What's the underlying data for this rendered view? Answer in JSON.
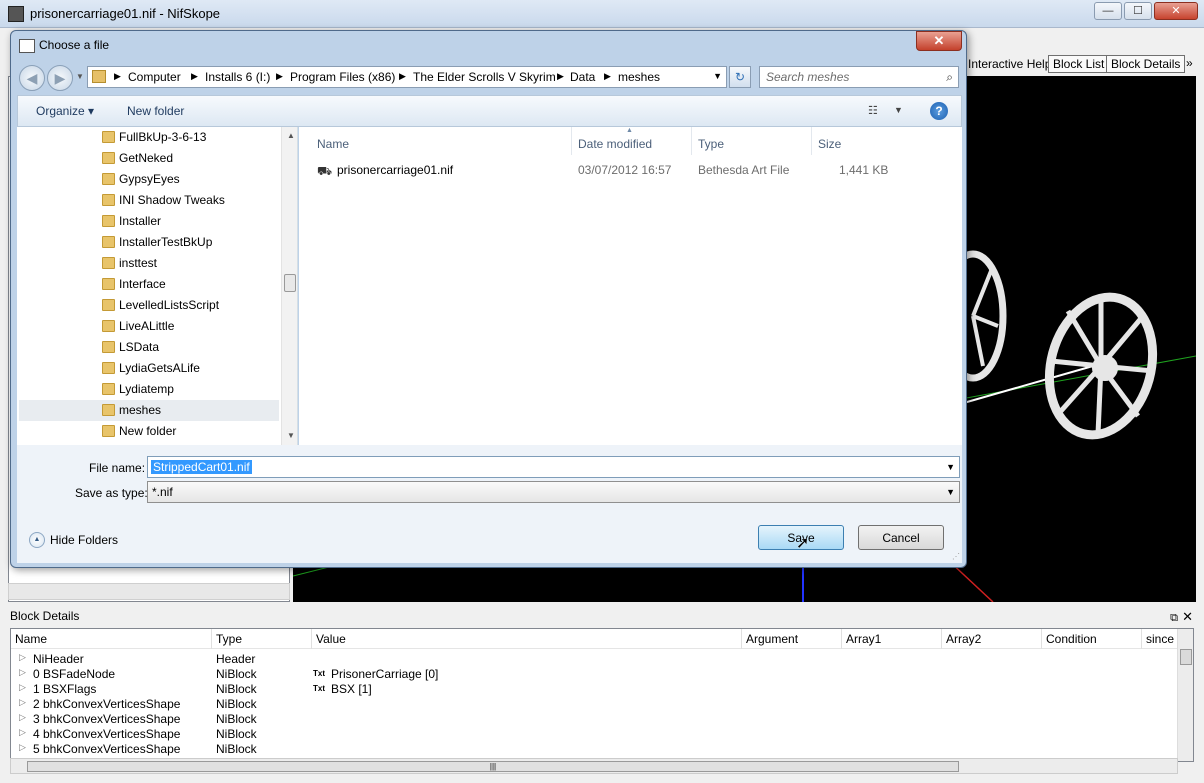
{
  "main_window": {
    "title": "prisonercarriage01.nif - NifSkope",
    "interactive_help": "Interactive Help",
    "tabs": [
      "Block List",
      "Block Details"
    ],
    "more": "»"
  },
  "block_details": {
    "title": "Block Details",
    "columns": [
      "Name",
      "Type",
      "Value",
      "Argument",
      "Array1",
      "Array2",
      "Condition",
      "since"
    ],
    "rows": [
      {
        "name": "NiHeader",
        "type": "Header",
        "tag": "",
        "value": ""
      },
      {
        "name": "0 BSFadeNode",
        "type": "NiBlock",
        "tag": "Txt",
        "value": "PrisonerCarriage [0]"
      },
      {
        "name": "1 BSXFlags",
        "type": "NiBlock",
        "tag": "Txt",
        "value": "BSX [1]"
      },
      {
        "name": "2 bhkConvexVerticesShape",
        "type": "NiBlock",
        "tag": "",
        "value": ""
      },
      {
        "name": "3 bhkConvexVerticesShape",
        "type": "NiBlock",
        "tag": "",
        "value": ""
      },
      {
        "name": "4 bhkConvexVerticesShape",
        "type": "NiBlock",
        "tag": "",
        "value": ""
      },
      {
        "name": "5 bhkConvexVerticesShape",
        "type": "NiBlock",
        "tag": "",
        "value": ""
      }
    ]
  },
  "dialog": {
    "title": "Choose a file",
    "close": "✕",
    "breadcrumb": [
      "Computer",
      "Installs 6 (I:)",
      "Program Files (x86)",
      "The Elder Scrolls V Skyrim",
      "Data",
      "meshes"
    ],
    "search_placeholder": "Search meshes",
    "organize": "Organize ▾",
    "new_folder": "New folder",
    "help": "?",
    "folders": [
      "FullBkUp-3-6-13",
      "GetNeked",
      "GypsyEyes",
      "INI Shadow Tweaks",
      "Installer",
      "InstallerTestBkUp",
      "insttest",
      "Interface",
      "LevelledListsScript",
      "LiveALittle",
      "LSData",
      "LydiaGetsALife",
      "Lydiatemp",
      "meshes",
      "New folder"
    ],
    "selected_folder": "meshes",
    "file_columns": [
      "Name",
      "Date modified",
      "Type",
      "Size"
    ],
    "files": [
      {
        "name": "prisonercarriage01.nif",
        "date": "03/07/2012 16:57",
        "type": "Bethesda Art File",
        "size": "1,441 KB"
      }
    ],
    "file_name_label": "File name:",
    "file_name_value": "StrippedCart01.nif",
    "save_type_label": "Save as type:",
    "save_type_value": "*.nif",
    "hide_folders": "Hide Folders",
    "save_label": "Save",
    "cancel_label": "Cancel"
  }
}
